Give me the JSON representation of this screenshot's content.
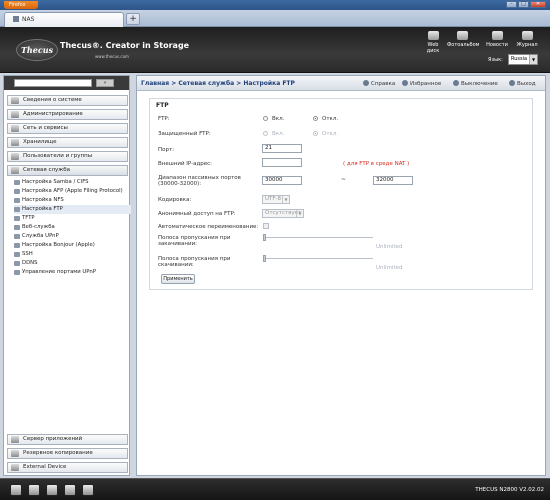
{
  "browser": {
    "app_button": "Firefox",
    "tab_title": "NAS",
    "new_tab": "+",
    "controls": [
      "–",
      "□",
      "✕"
    ]
  },
  "header": {
    "brand": "Thecus®. Creator in Storage",
    "brand_url": "www.thecus.com",
    "logo_text": "Thecus",
    "nav": [
      {
        "label": "Web\nдиск",
        "icon": "web-disk-icon"
      },
      {
        "label": "Фотоальбом",
        "icon": "photo-album-icon"
      },
      {
        "label": "Новости",
        "icon": "news-icon"
      },
      {
        "label": "Журнал",
        "icon": "log-icon"
      }
    ],
    "language_label": "Язык:",
    "language_value": "Russia"
  },
  "sidebar": {
    "search_button": "»",
    "categories_top": [
      "Сведения о системе",
      "Администрирование",
      "Сеть и сервисы",
      "Хранилище",
      "Пользователи и группы",
      "Сетевая служба"
    ],
    "subitems": [
      "Настройка Samba / CIFS",
      "Настройка AFP (Apple Filing Protocol)",
      "Настройка NFS",
      "Настройка FTP",
      "TFTP",
      "Веб-служба",
      "Служба UPnP",
      "Настройка Bonjour (Apple)",
      "SSH",
      "DDNS",
      "Управление портами UPnP"
    ],
    "active_subitem": "Настройка FTP",
    "categories_bottom": [
      "Сервер приложений",
      "Резервное копирование",
      "External Device"
    ]
  },
  "breadcrumb": "Главная > Сетевая служба > Настройка FTP",
  "toolbar": {
    "help": "Справка",
    "favorites": "Избранное",
    "shutdown": "Выключение",
    "logout": "Выход"
  },
  "ftp": {
    "section_title": "FTP",
    "ftp_label": "FTP:",
    "on": "Вкл.",
    "off": "Откл.",
    "ftp_enabled": false,
    "secure_label": "Защищенный FTP:",
    "secure_enabled": false,
    "port_label": "Порт:",
    "port_value": "21",
    "external_ip_label": "Внешний IP-адрес:",
    "external_ip_value": "",
    "nat_note": "( для FTP в среде NAT )",
    "passive_label": "Диапазон пассивных портов (30000-32000):",
    "passive_from": "30000",
    "passive_sep": "~",
    "passive_to": "32000",
    "encoding_label": "Кодировка:",
    "encoding_value": "UTF-8",
    "anon_label": "Анонимный доступ на FTP:",
    "anon_value": "Отсутствует",
    "auto_rename_label": "Автоматическое переименование:",
    "upload_label": "Полоса пропускания при закачивании:",
    "upload_value": "Unlimited",
    "download_label": "Полоса пропускания при скачивании:",
    "download_value": "Unlimited",
    "apply": "Применить"
  },
  "footer": {
    "model": "THECUS N2800 V2.02.02"
  }
}
